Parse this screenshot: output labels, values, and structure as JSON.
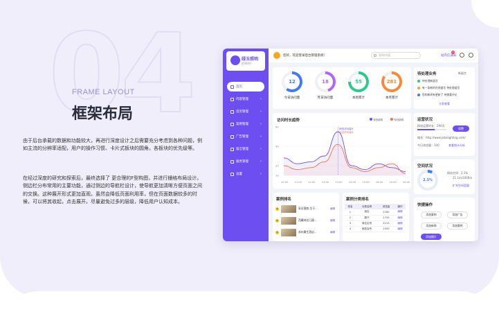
{
  "hero": {
    "big_number": "04",
    "frame_title": "FRAME LAYOUT",
    "cn_title": "框架布局",
    "paragraph1": "由于后台承载的数据和功能较大，再进行深度设计之后需要充分考虑到各种问题，例如主流的分辨率适配，用户的操作习惯、卡片式板块的圆角，各板块的优先级等。",
    "paragraph2": "在经过深度的研究和探索后，最终选择了 更合理的F型构图，并进行栅格布局设计。侧边栏分布常用的主要功能，通过侧边的导航栏设计，使导航更加清晰方便页面之间的交换。这种展开形式更加直观，虽然会降低页面利用率，但在页面数据较多的时候，可以将其收起，点击展开。尽量避免过多的层级，降低用户认知成本。"
  },
  "app": {
    "logo_text": "绿玉照明",
    "logo_sub": "JOBIAO",
    "greeting": "您好，欢迎登录后台管理系统!",
    "search_placeholder": "案例/内容",
    "message_label": "站内信通知",
    "message_count": "2",
    "nav": [
      {
        "label": "首页",
        "active": true
      },
      {
        "label": "内容管理",
        "active": false
      },
      {
        "label": "首页管理",
        "active": false
      },
      {
        "label": "案例管理",
        "active": false
      },
      {
        "label": "广告管理",
        "active": false
      },
      {
        "label": "留言管理",
        "active": false
      },
      {
        "label": "服务管理",
        "active": false
      },
      {
        "label": "设置",
        "active": false
      }
    ],
    "stats": [
      {
        "value": "12",
        "label": "今日访问量",
        "color": "#3d7bf7",
        "fill": 0.6
      },
      {
        "value": "18",
        "label": "昨日访问量",
        "color": "#b266f5",
        "fill": 0.45
      },
      {
        "value": "55",
        "label": "本周累计",
        "color": "#2dc98a",
        "fill": 0.75
      },
      {
        "value": "281",
        "label": "本月累计",
        "color": "#f58a3d",
        "fill": 0.85
      }
    ],
    "todo": {
      "title": "待处理业务",
      "right_label": "新留言",
      "items": [
        {
          "text": "待处理新留言",
          "color": "#2dc98a"
        },
        {
          "text": "有一条新的在线留言 待处理留言",
          "color": "#f5a623"
        },
        {
          "text": "您的新闻有更新了 待查看评论",
          "color": "#3d7bf7"
        }
      ],
      "link": "立即查看"
    },
    "chart": {
      "title": "访问时长趋势",
      "legend": [
        "今日访问",
        "今日访问"
      ],
      "legend_colors": [
        "#6d4ef0",
        "#f0704e"
      ],
      "tooltip": [
        "网页访问量9",
        "今日访问量8"
      ],
      "y_ticks": [
        "60",
        "40",
        "20",
        "10"
      ],
      "x_ticks": [
        "10:00",
        "11:00",
        "12:00",
        "13:00",
        "13:00",
        "14:00",
        "15:00",
        "16:00",
        "20:00",
        "24:00"
      ]
    },
    "chart_data": {
      "type": "line",
      "x": [
        "10:00",
        "11:00",
        "12:00",
        "13:00",
        "13:00",
        "14:00",
        "15:00",
        "16:00",
        "20:00",
        "24:00"
      ],
      "series": [
        {
          "name": "今日访问",
          "values": [
            28,
            22,
            24,
            30,
            55,
            20,
            16,
            22,
            18,
            14
          ]
        },
        {
          "name": "今日访问",
          "values": [
            20,
            16,
            18,
            24,
            42,
            18,
            14,
            18,
            22,
            12
          ]
        }
      ],
      "ylim": [
        10,
        60
      ],
      "title": "访问时长趋势"
    },
    "ops": {
      "title": "运营状况",
      "lines": [
        "网站运营时长：290天",
        "域名：http://www.jobalighting.com/",
        "今日浏览量：100"
      ],
      "button": "续费",
      "link": "查看统计分析"
    },
    "space": {
      "title": "空间状况",
      "percent": "2.1%",
      "fill": 0.021,
      "lines": [
        "网站空间：2.1%",
        "21.1m/1000m"
      ],
      "link": "扩充空间容量"
    },
    "cases": {
      "title": "案例排名",
      "items": [
        {
          "rank": "1",
          "text": "采访营商-生于...",
          "op": "编辑"
        },
        {
          "rank": "2",
          "text": "西藏林芝已建...",
          "op": "编辑"
        },
        {
          "rank": "3",
          "text": "苏州康生酒店...",
          "op": "编辑"
        }
      ]
    },
    "category": {
      "title": "案例分类排名",
      "headers": [
        "排名",
        "分类名称",
        "浏览量",
        "操作"
      ],
      "rows": [
        [
          "1",
          "酒店",
          "2160",
          "编辑"
        ],
        [
          "2",
          "展厅",
          "1733",
          "编辑"
        ],
        [
          "3",
          "商住区别",
          "4113",
          "编辑"
        ],
        [
          "4",
          "家居会所",
          "1950",
          "编辑"
        ]
      ]
    },
    "quick": {
      "title": "快捷操作",
      "buttons": [
        "添加案例",
        "添加广告",
        "添加新闻",
        "添加案例"
      ],
      "primary": "添加图片"
    }
  }
}
